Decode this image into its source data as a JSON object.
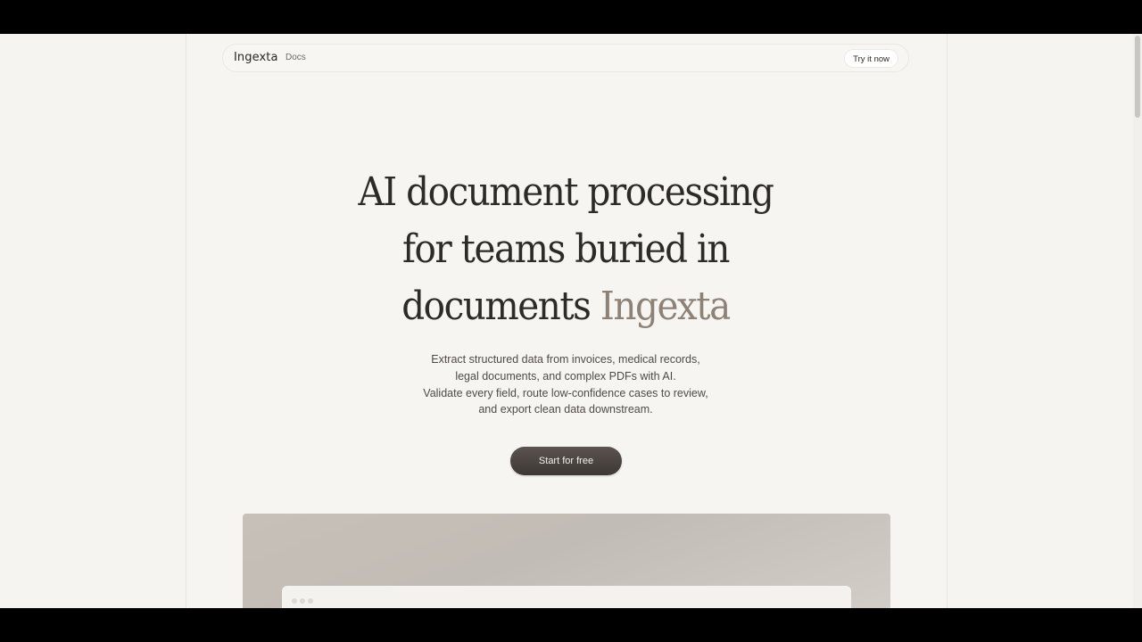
{
  "nav": {
    "brand": "Ingexta",
    "docs_label": "Docs",
    "try_label": "Try it now"
  },
  "hero": {
    "headline_line1": "AI document processing",
    "headline_line2": "for teams buried in",
    "headline_line3_prefix": "documents",
    "headline_line3_accent": "Ingexta",
    "sub_lines": [
      "Extract structured data from invoices, medical records,",
      "legal documents, and complex PDFs with AI.",
      "Validate every field, route low-confidence cases to review,",
      "and export clean data downstream."
    ],
    "cta_label": "Start for free"
  },
  "colors": {
    "background": "#f5f4f1",
    "text": "#2d2a27",
    "accent": "#8d8275",
    "cta": "#4a4340"
  }
}
